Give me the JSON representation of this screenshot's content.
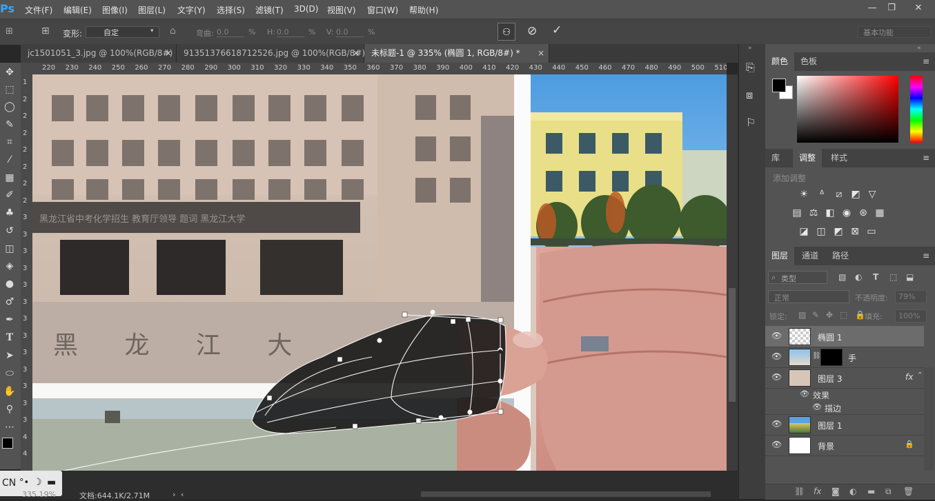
{
  "app": {
    "logo": "Ps"
  },
  "menu": [
    "文件(F)",
    "编辑(E)",
    "图像(I)",
    "图层(L)",
    "文字(Y)",
    "选择(S)",
    "滤镜(T)",
    "3D(D)",
    "视图(V)",
    "窗口(W)",
    "帮助(H)"
  ],
  "window_controls": {
    "min": "—",
    "restore": "❐",
    "close": "✕"
  },
  "options": {
    "transform_label": "变形:",
    "transform_value": "自定",
    "bend_label": "弯曲:",
    "bend_value": "0.0",
    "h_label": "H:",
    "h_value": "0.0",
    "v_label": "V:",
    "v_value": "0.0",
    "percent": "%",
    "workspace": "基本功能"
  },
  "tabs": [
    {
      "label": "jc1501051_3.jpg @ 100%(RGB/8#)",
      "close": "×"
    },
    {
      "label": "91351376618712526.jpg @ 100%(RGB/8#)",
      "close": "×"
    },
    {
      "label": "未标题-1 @ 335% (椭圆 1, RGB/8#) *",
      "close": "×",
      "active": true
    }
  ],
  "ruler_top": [
    "220",
    "230",
    "240",
    "250",
    "260",
    "270",
    "280",
    "290",
    "300",
    "310",
    "320",
    "330",
    "340",
    "350",
    "360",
    "370",
    "380",
    "390",
    "400",
    "410",
    "420",
    "430",
    "440",
    "450",
    "460",
    "470",
    "480",
    "490",
    "500",
    "510"
  ],
  "ruler_left": [
    "1",
    "2",
    "2",
    "2",
    "2",
    "2",
    "2",
    "2",
    "3",
    "3",
    "3",
    "3",
    "3",
    "3",
    "3",
    "3",
    "3",
    "3",
    "3",
    "3",
    "3",
    "4",
    "4"
  ],
  "canvas": {
    "sign_text": "黑 龙 江 大",
    "banner_text": "黑龙江省中考化学招生 教育厅领导 题词 黑龙江大学"
  },
  "status": {
    "zoom": "335.19%",
    "doc": "文档:644.1K/2.71M",
    "ime": "CN"
  },
  "color_panel": {
    "tabs": [
      "颜色",
      "色板"
    ]
  },
  "adjust_panel": {
    "tabs": [
      "库",
      "调整",
      "样式"
    ],
    "hint": "添加调整"
  },
  "layers_panel": {
    "tabs": [
      "图层",
      "通道",
      "路径"
    ],
    "filter_kind": "类型",
    "blend_mode": "正常",
    "opacity_label": "不透明度:",
    "opacity_value": "79%",
    "lock_label": "锁定:",
    "fill_label": "填充:",
    "fill_value": "100%",
    "layers": [
      {
        "name": "椭圆 1",
        "selected": true
      },
      {
        "name": "手"
      },
      {
        "name": "图层 3",
        "fx": "fx"
      },
      {
        "name": "效果",
        "sub": true
      },
      {
        "name": "描边",
        "sub": true
      },
      {
        "name": "图层 1"
      },
      {
        "name": "背景",
        "lock": "🔒"
      }
    ]
  },
  "colors": {
    "fg": "#000000",
    "bg": "#ffffff",
    "accent": "#31a8ff"
  }
}
